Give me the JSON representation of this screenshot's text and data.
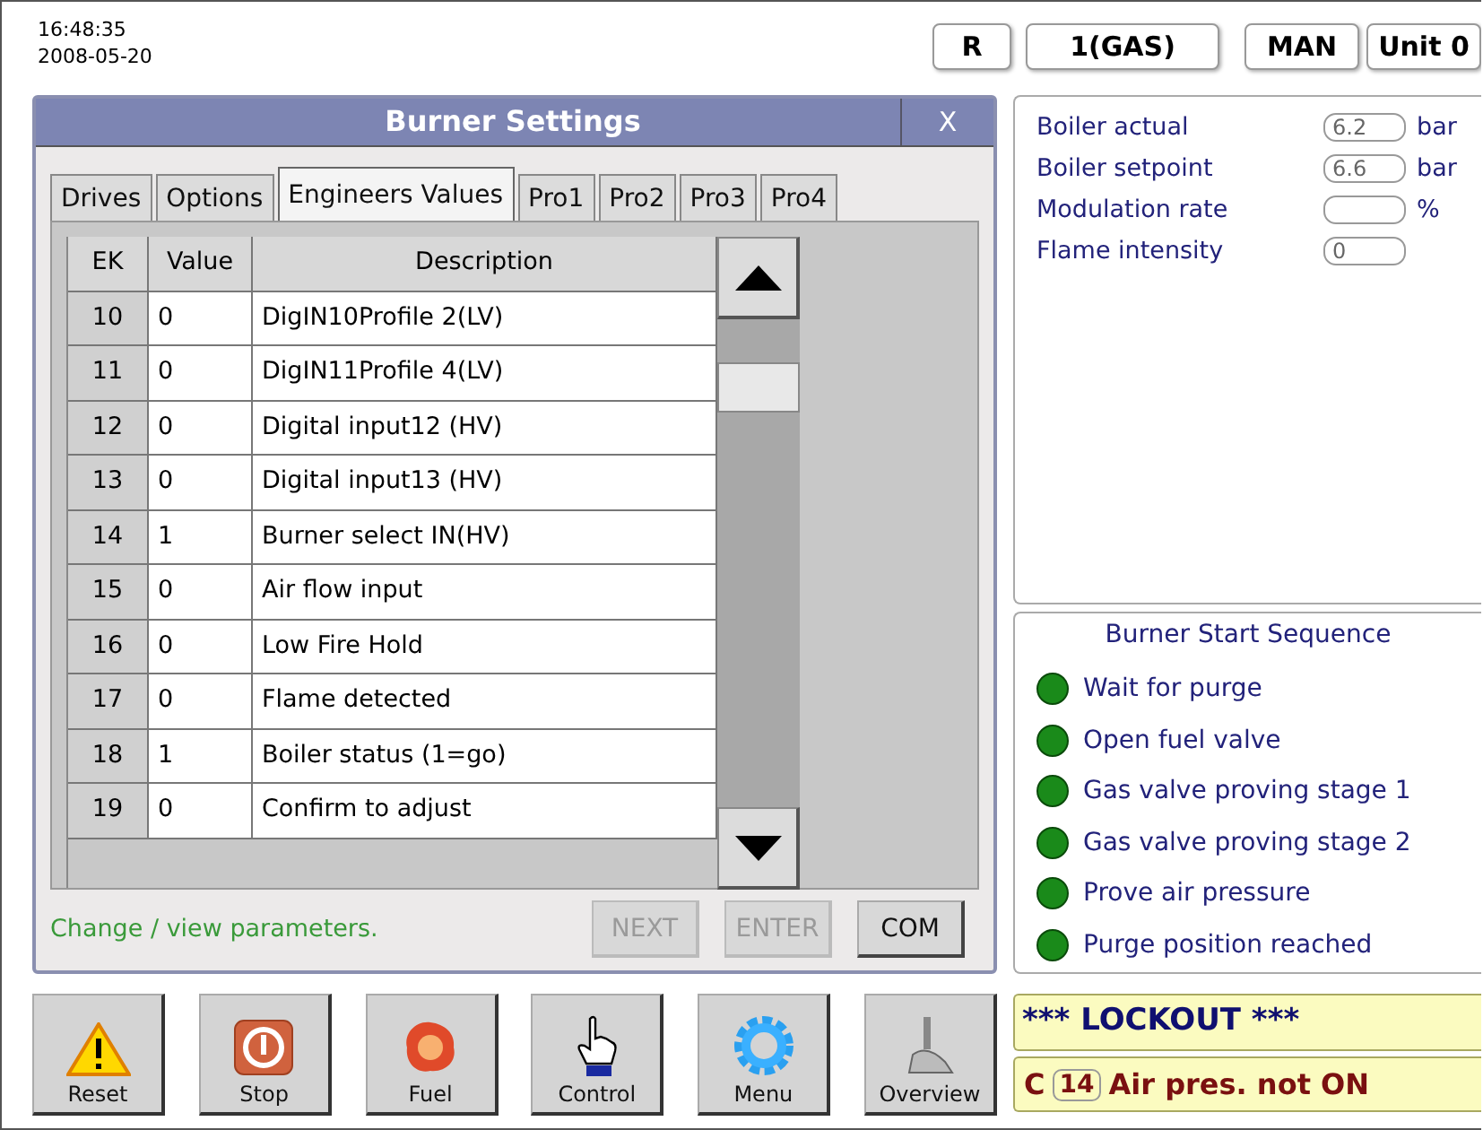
{
  "header": {
    "time": "16:48:35",
    "date": "2008-05-20",
    "indicators": [
      "R",
      "1(GAS)",
      "MAN",
      "Unit 0"
    ]
  },
  "dialog": {
    "title": "Burner Settings",
    "close": "X",
    "tabs": [
      {
        "label": "Drives",
        "selected": false
      },
      {
        "label": "Options",
        "selected": false
      },
      {
        "label": "Engineers Values",
        "selected": true
      },
      {
        "label": "Pro1",
        "selected": false
      },
      {
        "label": "Pro2",
        "selected": false
      },
      {
        "label": "Pro3",
        "selected": false
      },
      {
        "label": "Pro4",
        "selected": false
      }
    ],
    "table": {
      "columns": [
        "EK",
        "Value",
        "Description"
      ],
      "rows": [
        [
          "10",
          "0",
          "DigIN10Profile 2(LV)"
        ],
        [
          "11",
          "0",
          "DigIN11Profile 4(LV)"
        ],
        [
          "12",
          "0",
          "Digital input12 (HV)"
        ],
        [
          "13",
          "0",
          "Digital input13 (HV)"
        ],
        [
          "14",
          "1",
          "Burner select IN(HV)"
        ],
        [
          "15",
          "0",
          "Air flow input"
        ],
        [
          "16",
          "0",
          "Low Fire Hold"
        ],
        [
          "17",
          "0",
          "Flame detected"
        ],
        [
          "18",
          "1",
          "Boiler status (1=go)"
        ],
        [
          "19",
          "0",
          "Confirm to adjust"
        ]
      ]
    },
    "hint": "Change / view parameters.",
    "buttons": [
      {
        "label": "NEXT",
        "disabled": true
      },
      {
        "label": "ENTER",
        "disabled": true
      },
      {
        "label": "COM",
        "disabled": false
      }
    ]
  },
  "readings": [
    {
      "label": "Boiler actual",
      "value": "6.2",
      "unit": "bar"
    },
    {
      "label": "Boiler setpoint",
      "value": "6.6",
      "unit": "bar"
    },
    {
      "label": "Modulation rate",
      "unit": "%"
    },
    {
      "label": "Flame intensity",
      "value": "0"
    }
  ],
  "sequence": {
    "title": "Burner Start Sequence",
    "steps": [
      {
        "label": "Wait for purge",
        "active": true
      },
      {
        "label": "Open fuel valve",
        "active": true
      },
      {
        "label": "Gas valve proving stage 1",
        "active": true
      },
      {
        "label": "Gas valve proving stage 2",
        "active": true
      },
      {
        "label": "Prove air pressure",
        "active": true
      },
      {
        "label": "Purge position reached",
        "active": true
      }
    ]
  },
  "toolbar": [
    {
      "label": "Reset",
      "kind": "warning"
    },
    {
      "label": "Stop",
      "kind": "power"
    },
    {
      "label": "Fuel",
      "kind": "flame"
    },
    {
      "label": "Control",
      "kind": "hand"
    },
    {
      "label": "Menu",
      "kind": "gear"
    },
    {
      "label": "Overview",
      "kind": "probe"
    }
  ],
  "alarm": {
    "status": "*** LOCKOUT ***",
    "prefix": "C",
    "code": "14",
    "message": "Air pres. not ON"
  }
}
